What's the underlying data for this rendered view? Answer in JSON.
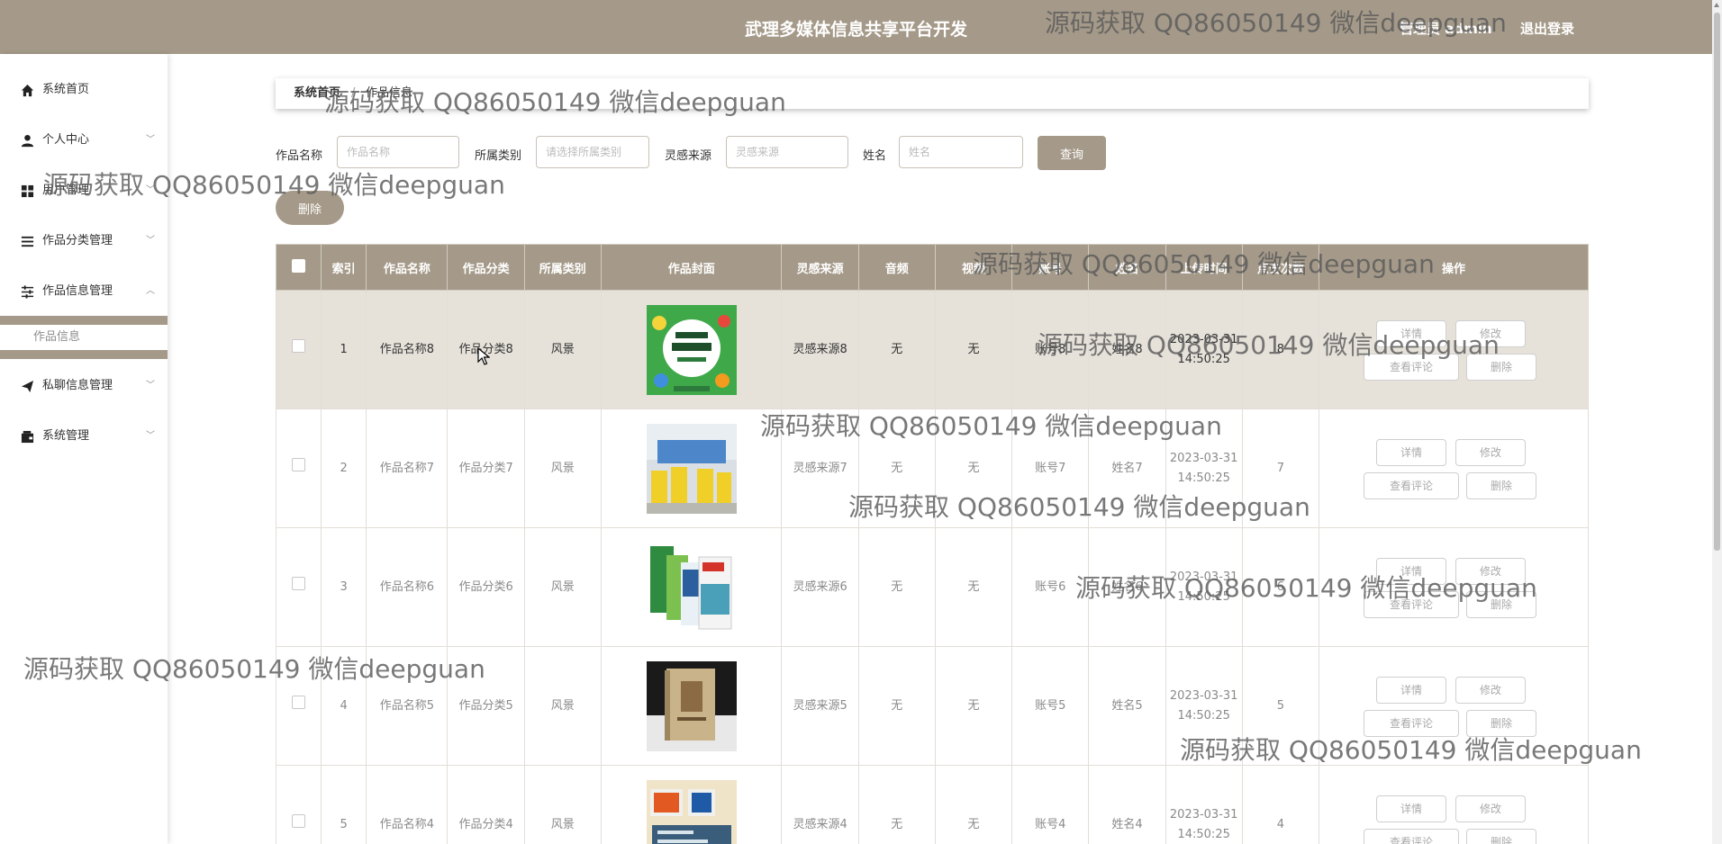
{
  "header": {
    "title": "武理多媒体信息共享平台开发",
    "user_label": "管理员 admin",
    "logout_label": "退出登录"
  },
  "sidebar": {
    "items": [
      {
        "label": "系统首页",
        "icon": "home-icon"
      },
      {
        "label": "个人中心",
        "icon": "person-icon"
      },
      {
        "label": "用户管理",
        "icon": "grid-icon"
      },
      {
        "label": "作品分类管理",
        "icon": "list-icon"
      },
      {
        "label": "作品信息管理",
        "icon": "sliders-icon"
      },
      {
        "label": "私聊信息管理",
        "icon": "send-icon"
      },
      {
        "label": "系统管理",
        "icon": "wallet-icon"
      }
    ],
    "submenu": {
      "label": "作品信息"
    }
  },
  "breadcrumb": {
    "home": "系统首页",
    "current": "作品信息"
  },
  "search": {
    "fields": [
      {
        "label": "作品名称",
        "placeholder": "作品名称"
      },
      {
        "label": "所属类别",
        "placeholder": "请选择所属类别"
      },
      {
        "label": "灵感来源",
        "placeholder": "灵感来源"
      },
      {
        "label": "姓名",
        "placeholder": "姓名"
      }
    ],
    "query_label": "查询",
    "delete_label": "删除"
  },
  "table": {
    "headers": [
      "索引",
      "作品名称",
      "作品分类",
      "所属类别",
      "作品封面",
      "灵感来源",
      "音频",
      "视频",
      "账号",
      "姓名",
      "上传时间",
      "点击次数",
      "操作"
    ],
    "rows": [
      {
        "index": "1",
        "name": "作品名称8",
        "category": "作品分类8",
        "type": "风景",
        "cover": "cover-brain-school",
        "source": "灵感来源8",
        "audio": "无",
        "video": "无",
        "account": "账号8",
        "realname": "姓名8",
        "time": "2023-03-31 14:50:25",
        "clicks": "8",
        "highlighted": true
      },
      {
        "index": "2",
        "name": "作品名称7",
        "category": "作品分类7",
        "type": "风景",
        "cover": "cover-students-wall",
        "source": "灵感来源7",
        "audio": "无",
        "video": "无",
        "account": "账号7",
        "realname": "姓名7",
        "time": "2023-03-31 14:50:25",
        "clicks": "7",
        "highlighted": false
      },
      {
        "index": "3",
        "name": "作品名称6",
        "category": "作品分类6",
        "type": "风景",
        "cover": "cover-magazines",
        "source": "灵感来源6",
        "audio": "无",
        "video": "无",
        "account": "账号6",
        "realname": "姓名6",
        "time": "2023-03-31 14:50:25",
        "clicks": "6",
        "highlighted": false
      },
      {
        "index": "4",
        "name": "作品名称5",
        "category": "作品分类5",
        "type": "风景",
        "cover": "cover-book",
        "source": "灵感来源5",
        "audio": "无",
        "video": "无",
        "account": "账号5",
        "realname": "姓名5",
        "time": "2023-03-31 14:50:25",
        "clicks": "5",
        "highlighted": false
      },
      {
        "index": "5",
        "name": "作品名称4",
        "category": "作品分类4",
        "type": "风景",
        "cover": "cover-wenyuan",
        "source": "灵感来源4",
        "audio": "无",
        "video": "无",
        "account": "账号4",
        "realname": "姓名4",
        "time": "2023-03-31 14:50:25",
        "clicks": "4",
        "highlighted": false
      }
    ],
    "ops": {
      "detail": "详情",
      "edit": "修改",
      "review": "查看评论",
      "del": "删除"
    }
  },
  "watermark": "源码获取 QQ86050149 微信deepguan",
  "colors": {
    "accent": "#a59a89",
    "highlight_row": "#e6e2da"
  }
}
